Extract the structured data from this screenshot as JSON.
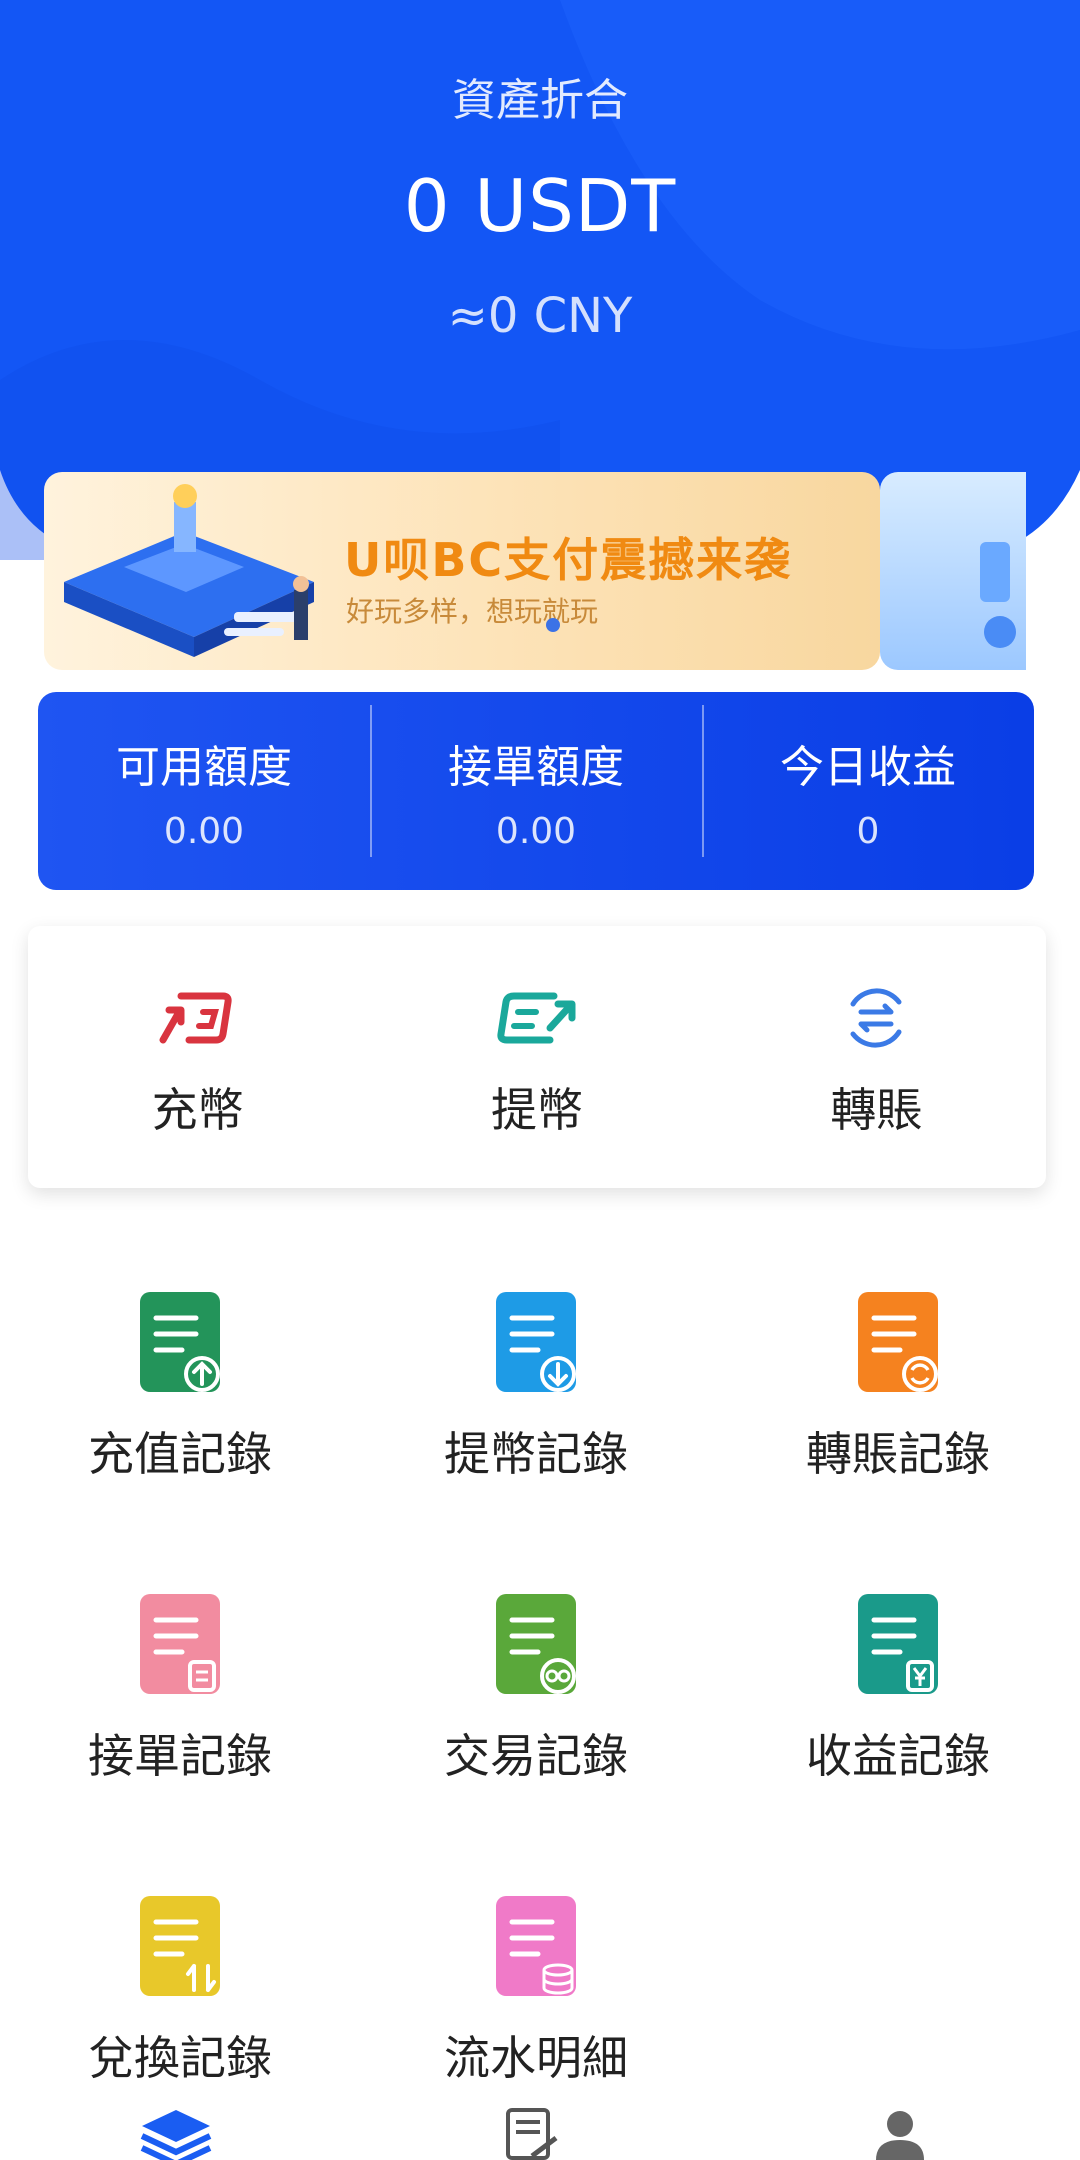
{
  "header": {
    "label": "資產折合",
    "amount": "0 USDT",
    "converted": "≈0 CNY"
  },
  "banner": {
    "title": "U呗BC支付震撼来袭",
    "subtitle": "好玩多样，想玩就玩"
  },
  "stats": [
    {
      "label": "可用額度",
      "value": "0.00"
    },
    {
      "label": "接單額度",
      "value": "0.00"
    },
    {
      "label": "今日收益",
      "value": "0"
    }
  ],
  "actions": [
    {
      "label": "充幣",
      "icon": "deposit-icon",
      "color": "#d9343f"
    },
    {
      "label": "提幣",
      "icon": "withdraw-icon",
      "color": "#1aa89b"
    },
    {
      "label": "轉賬",
      "icon": "transfer-icon",
      "color": "#3b7ae6"
    }
  ],
  "records": [
    {
      "label": "充值記錄",
      "icon": "recharge-record-icon",
      "color": "#23945a"
    },
    {
      "label": "提幣記錄",
      "icon": "withdraw-record-icon",
      "color": "#1e9be6"
    },
    {
      "label": "轉賬記錄",
      "icon": "transfer-record-icon",
      "color": "#f5821f"
    },
    {
      "label": "接單記錄",
      "icon": "order-record-icon",
      "color": "#f28ca0"
    },
    {
      "label": "交易記錄",
      "icon": "trade-record-icon",
      "color": "#5aa83a"
    },
    {
      "label": "收益記錄",
      "icon": "income-record-icon",
      "color": "#1a9a8a"
    },
    {
      "label": "兌換記錄",
      "icon": "exchange-record-icon",
      "color": "#e8c82a"
    },
    {
      "label": "流水明細",
      "icon": "flow-detail-icon",
      "color": "#f07ac8"
    }
  ],
  "nav": [
    {
      "icon": "layers-icon"
    },
    {
      "icon": "document-edit-icon"
    },
    {
      "icon": "user-icon"
    }
  ],
  "colors": {
    "primary": "#0a45ee",
    "hero": "#1356f5"
  }
}
